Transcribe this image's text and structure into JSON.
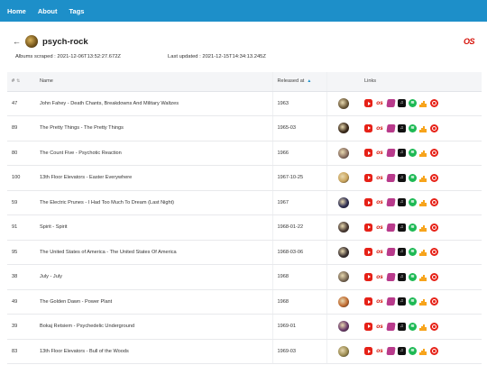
{
  "nav": {
    "items": [
      "Home",
      "About",
      "Tags"
    ]
  },
  "header": {
    "title": "psych-rock",
    "back_icon": "←",
    "lastfm_icon": "OS"
  },
  "meta": {
    "albums_scraped": "Albums scraped : 2021-12-06T13:52:27.672Z",
    "last_updated": "Last updated : 2021-12-15T14:34:13.245Z"
  },
  "table": {
    "headers": {
      "num": "#",
      "name": "Name",
      "released": "Released at",
      "links": "Links"
    },
    "rows": [
      {
        "num": "47",
        "name": "John Fahey - Death Chants, Breakdowns And Military Waltzes",
        "released": "1963",
        "cover": "#6e5b3a"
      },
      {
        "num": "89",
        "name": "The Pretty Things - The Pretty Things",
        "released": "1965-03",
        "cover": "#3b2a1a"
      },
      {
        "num": "80",
        "name": "The Count Five - Psychotic Reaction",
        "released": "1966",
        "cover": "#8a6f60"
      },
      {
        "num": "100",
        "name": "13th Floor Elevators - Easter Everywhere",
        "released": "1967-10-25",
        "cover": "#c9a35b"
      },
      {
        "num": "59",
        "name": "The Electric Prunes - I Had Too Much To Dream (Last Night)",
        "released": "1967",
        "cover": "#2d2d52"
      },
      {
        "num": "91",
        "name": "Spirit - Spirit",
        "released": "1968-01-22",
        "cover": "#4a3b34"
      },
      {
        "num": "95",
        "name": "The United States of America - The United States Of America",
        "released": "1968-03-06",
        "cover": "#3a3030"
      },
      {
        "num": "38",
        "name": "July - July",
        "released": "1968",
        "cover": "#7b6a55"
      },
      {
        "num": "49",
        "name": "The Golden Dawn - Power Plant",
        "released": "1968",
        "cover": "#c06a30"
      },
      {
        "num": "39",
        "name": "Bokaj Retsiem - Psychedelic Underground",
        "released": "1969-01",
        "cover": "#6a3a6a"
      },
      {
        "num": "83",
        "name": "13th Floor Elevators - Bull of the Woods",
        "released": "1969-03",
        "cover": "#9a8a50"
      }
    ]
  },
  "link_icons": [
    "youtube-icon",
    "lastfm-icon",
    "musicbrainz-icon",
    "apple-music-icon",
    "spotify-icon",
    "deezer-icon",
    "youtube-music-icon"
  ],
  "colors": {
    "nav": "#1d8fc9",
    "lastfm": "#d51007",
    "youtube": "#e62117",
    "spotify": "#1db954",
    "deezer": "#f7a41c",
    "musicbrainz": "#b83a8b"
  }
}
